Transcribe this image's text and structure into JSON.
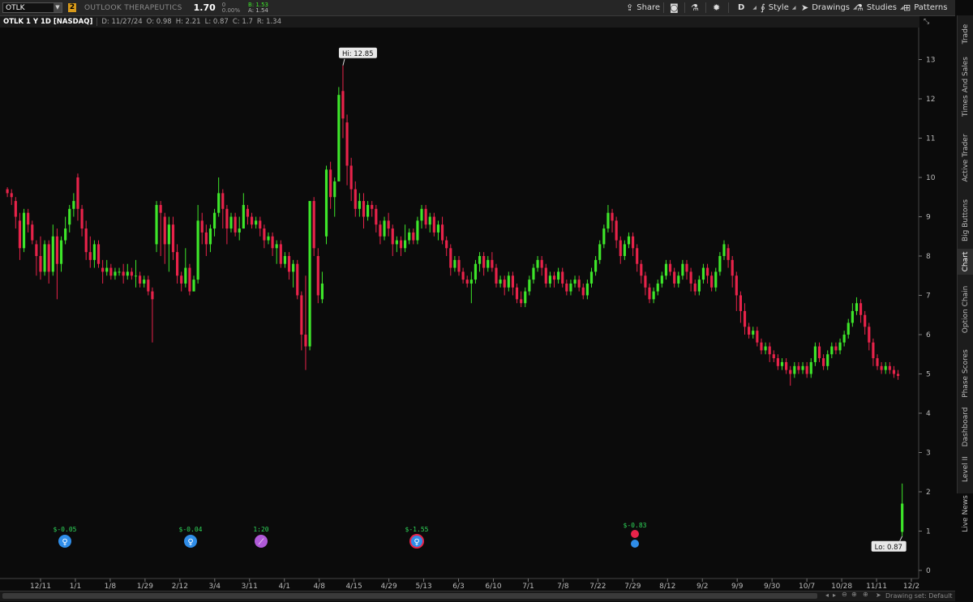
{
  "toolbar": {
    "symbol": "OTLK",
    "link_badge": "2",
    "company": "OUTLOOK THERAPEUTICS",
    "last": "1.70",
    "change": "0",
    "change_pct": "0.00%",
    "bid": "B: 1.53",
    "ask": "A: 1.54",
    "share_label": "Share",
    "aggregation_label": "D",
    "style_label": "Style",
    "drawings_label": "Drawings",
    "studies_label": "Studies",
    "patterns_label": "Patterns"
  },
  "infobar": {
    "title": "OTLK 1 Y 1D [NASDAQ]",
    "date": "D: 11/27/24",
    "open": "O: 0.98",
    "high": "H: 2.21",
    "low": "L: 0.87",
    "close": "C: 1.7",
    "range": "R: 1.34"
  },
  "side_tabs": [
    "Trade",
    "Times And Sales",
    "Active Trader",
    "Big Buttons",
    "Chart",
    "Option Chain",
    "Phase Scores",
    "Dashboard",
    "Level II",
    "Live News"
  ],
  "active_side_tab": "Chart",
  "status": {
    "drawing_set": "Drawing set: Default"
  },
  "colors": {
    "up": "#3ee62a",
    "down": "#e8234a",
    "background": "#0b0b0b",
    "earnings_blue": "#2f8de8",
    "event_purple": "#b05ad8"
  },
  "chart_data": {
    "type": "candlestick",
    "ylim": [
      0,
      13.6
    ],
    "y_ticks": [
      0,
      1,
      2,
      3,
      4,
      5,
      6,
      7,
      8,
      9,
      10,
      11,
      12,
      13
    ],
    "x_ticks": [
      "12/11",
      "1/1",
      "1/8",
      "1/29",
      "2/12",
      "3/4",
      "3/11",
      "4/1",
      "4/8",
      "4/15",
      "4/29",
      "5/13",
      "6/3",
      "6/10",
      "7/1",
      "7/8",
      "7/22",
      "7/29",
      "8/12",
      "9/2",
      "9/9",
      "9/30",
      "10/7",
      "10/28",
      "11/11",
      "12/2"
    ],
    "annotations": {
      "high": "Hi: 12.85",
      "low": "Lo: 0.87"
    },
    "events": [
      {
        "label": "$-0.05",
        "type": "earnings",
        "icon": "lightbulb-icon"
      },
      {
        "label": "$-0.04",
        "type": "earnings",
        "icon": "lightbulb-icon"
      },
      {
        "label": "1:20",
        "type": "split",
        "icon": "split-icon"
      },
      {
        "label": "$-1.55",
        "type": "earnings",
        "icon": "lightbulb-icon"
      },
      {
        "label": "$-0.83",
        "type": "earnings-miss",
        "icon": "lightbulb-icon"
      }
    ],
    "candles": [
      [
        9.7,
        9.6,
        9.75,
        9.5
      ],
      [
        9.6,
        9.5,
        9.7,
        9.3
      ],
      [
        9.4,
        9.0,
        9.5,
        8.7
      ],
      [
        8.9,
        8.2,
        9.1,
        7.9
      ],
      [
        8.2,
        9.1,
        9.2,
        8.1
      ],
      [
        9.1,
        8.8,
        9.2,
        8.6
      ],
      [
        8.8,
        8.4,
        8.9,
        8.3
      ],
      [
        8.3,
        8.0,
        8.4,
        7.5
      ],
      [
        8.0,
        7.6,
        8.5,
        7.4
      ],
      [
        7.6,
        8.3,
        8.4,
        7.5
      ],
      [
        8.3,
        7.6,
        8.4,
        7.3
      ],
      [
        7.6,
        8.5,
        8.8,
        7.5
      ],
      [
        8.5,
        7.8,
        8.7,
        6.9
      ],
      [
        7.8,
        8.4,
        8.5,
        7.6
      ],
      [
        8.4,
        8.7,
        9.0,
        8.3
      ],
      [
        8.8,
        9.2,
        9.3,
        8.6
      ],
      [
        9.2,
        9.4,
        9.6,
        9.0
      ],
      [
        10.0,
        9.2,
        10.1,
        8.9
      ],
      [
        9.2,
        8.7,
        9.3,
        8.5
      ],
      [
        8.7,
        8.1,
        8.9,
        7.9
      ],
      [
        8.1,
        7.9,
        8.5,
        7.7
      ],
      [
        7.9,
        8.3,
        8.4,
        7.7
      ],
      [
        8.3,
        7.8,
        8.4,
        7.7
      ],
      [
        7.7,
        7.6,
        7.9,
        7.3
      ],
      [
        7.6,
        7.7,
        7.9,
        7.5
      ],
      [
        7.7,
        7.5,
        7.8,
        7.4
      ],
      [
        7.5,
        7.6,
        7.7,
        7.4
      ],
      [
        7.6,
        7.6,
        7.7,
        7.5
      ],
      [
        7.6,
        7.5,
        7.8,
        7.3
      ],
      [
        7.5,
        7.6,
        7.8,
        7.4
      ],
      [
        7.6,
        7.5,
        7.7,
        7.4
      ],
      [
        7.5,
        7.5,
        7.9,
        7.2
      ],
      [
        7.5,
        7.3,
        7.6,
        7.2
      ],
      [
        7.3,
        7.4,
        7.5,
        7.2
      ],
      [
        7.4,
        7.1,
        7.5,
        7.0
      ],
      [
        7.1,
        6.9,
        7.2,
        5.8
      ],
      [
        8.3,
        9.3,
        9.4,
        8.1
      ],
      [
        9.3,
        9.1,
        9.4,
        8.0
      ],
      [
        9.0,
        8.3,
        9.1,
        7.8
      ],
      [
        8.3,
        8.8,
        9.0,
        7.6
      ],
      [
        8.8,
        8.1,
        9.0,
        7.9
      ],
      [
        8.1,
        7.5,
        8.3,
        7.3
      ],
      [
        7.5,
        7.3,
        7.6,
        7.1
      ],
      [
        7.3,
        7.7,
        8.2,
        7.2
      ],
      [
        7.7,
        7.1,
        7.8,
        7.0
      ],
      [
        7.1,
        7.4,
        7.5,
        7.1
      ],
      [
        7.4,
        8.9,
        9.3,
        7.3
      ],
      [
        8.9,
        8.6,
        9.1,
        8.3
      ],
      [
        8.6,
        8.3,
        8.8,
        8.0
      ],
      [
        8.3,
        8.7,
        8.8,
        8.1
      ],
      [
        8.7,
        9.1,
        9.2,
        8.5
      ],
      [
        9.1,
        9.6,
        10.0,
        9.0
      ],
      [
        9.6,
        9.2,
        9.7,
        8.7
      ],
      [
        9.2,
        8.7,
        9.3,
        8.3
      ],
      [
        8.7,
        9.0,
        9.1,
        8.6
      ],
      [
        9.0,
        8.6,
        9.1,
        8.5
      ],
      [
        8.6,
        8.7,
        9.0,
        8.4
      ],
      [
        8.7,
        9.3,
        9.6,
        8.7
      ],
      [
        9.2,
        9.0,
        9.3,
        8.8
      ],
      [
        9.0,
        8.8,
        9.1,
        8.7
      ],
      [
        8.8,
        8.9,
        9.0,
        8.7
      ],
      [
        8.9,
        8.7,
        9.0,
        8.5
      ],
      [
        8.7,
        8.4,
        8.8,
        8.2
      ],
      [
        8.4,
        8.5,
        8.6,
        8.3
      ],
      [
        8.5,
        8.2,
        8.6,
        8.0
      ],
      [
        8.2,
        8.3,
        8.4,
        7.8
      ],
      [
        8.3,
        7.8,
        8.4,
        7.7
      ],
      [
        7.8,
        8.0,
        8.1,
        7.7
      ],
      [
        8.0,
        7.6,
        8.1,
        7.4
      ],
      [
        7.6,
        7.8,
        7.9,
        7.2
      ],
      [
        7.8,
        7.0,
        7.9,
        6.9
      ],
      [
        7.0,
        6.0,
        7.1,
        5.6
      ],
      [
        6.0,
        5.7,
        7.5,
        5.1
      ],
      [
        5.7,
        9.4,
        9.4,
        5.6
      ],
      [
        9.4,
        8.2,
        9.5,
        8.0
      ],
      [
        8.0,
        7.0,
        8.2,
        6.8
      ],
      [
        6.9,
        7.3,
        7.6,
        6.8
      ],
      [
        8.5,
        10.2,
        10.3,
        8.3
      ],
      [
        10.2,
        9.5,
        10.4,
        9.2
      ],
      [
        9.5,
        9.9,
        10.0,
        9.0
      ],
      [
        9.9,
        12.1,
        12.3,
        9.9
      ],
      [
        12.2,
        11.5,
        12.85,
        11.0
      ],
      [
        11.4,
        10.3,
        11.6,
        9.8
      ],
      [
        10.3,
        9.7,
        10.5,
        9.4
      ],
      [
        9.7,
        9.2,
        9.9,
        9.0
      ],
      [
        9.2,
        9.4,
        9.6,
        9.0
      ],
      [
        9.4,
        9.0,
        9.6,
        8.7
      ],
      [
        9.0,
        9.3,
        9.4,
        8.9
      ],
      [
        9.3,
        9.2,
        9.4,
        9.0
      ],
      [
        9.2,
        8.8,
        9.3,
        8.6
      ],
      [
        8.8,
        8.5,
        8.9,
        8.3
      ],
      [
        8.5,
        8.9,
        9.0,
        8.4
      ],
      [
        8.9,
        8.7,
        9.1,
        8.5
      ],
      [
        8.7,
        8.3,
        8.8,
        8.0
      ],
      [
        8.3,
        8.4,
        8.5,
        8.1
      ],
      [
        8.4,
        8.2,
        8.5,
        8.0
      ],
      [
        8.2,
        8.4,
        8.8,
        8.1
      ],
      [
        8.4,
        8.6,
        8.7,
        8.3
      ],
      [
        8.6,
        8.4,
        8.7,
        8.3
      ],
      [
        8.4,
        8.9,
        9.0,
        8.3
      ],
      [
        8.9,
        9.2,
        9.3,
        8.7
      ],
      [
        9.2,
        8.8,
        9.3,
        8.7
      ],
      [
        8.8,
        9.0,
        9.1,
        8.6
      ],
      [
        9.0,
        8.6,
        9.1,
        8.5
      ],
      [
        8.6,
        8.8,
        8.9,
        8.4
      ],
      [
        8.8,
        8.4,
        9.0,
        8.3
      ],
      [
        8.4,
        8.2,
        8.5,
        8.0
      ],
      [
        8.2,
        7.7,
        8.3,
        7.5
      ],
      [
        7.7,
        7.9,
        8.0,
        7.6
      ],
      [
        7.9,
        7.6,
        8.0,
        7.5
      ],
      [
        7.6,
        7.4,
        7.7,
        7.3
      ],
      [
        7.4,
        7.3,
        7.5,
        7.2
      ],
      [
        7.3,
        7.4,
        7.6,
        6.8
      ],
      [
        7.4,
        7.8,
        7.9,
        7.3
      ],
      [
        7.8,
        8.0,
        8.1,
        7.6
      ],
      [
        8.0,
        7.7,
        8.1,
        7.5
      ],
      [
        7.7,
        7.9,
        8.0,
        7.6
      ],
      [
        7.9,
        7.7,
        8.1,
        7.6
      ],
      [
        7.7,
        7.3,
        7.8,
        7.2
      ],
      [
        7.3,
        7.4,
        7.5,
        7.2
      ],
      [
        7.4,
        7.2,
        7.5,
        7.0
      ],
      [
        7.2,
        7.5,
        7.6,
        7.1
      ],
      [
        7.5,
        7.2,
        7.6,
        7.0
      ],
      [
        7.2,
        6.9,
        7.3,
        6.8
      ],
      [
        6.9,
        6.8,
        7.1,
        6.7
      ],
      [
        6.8,
        7.1,
        7.2,
        6.7
      ],
      [
        7.1,
        7.4,
        7.5,
        7.0
      ],
      [
        7.4,
        7.7,
        7.8,
        7.3
      ],
      [
        7.7,
        7.9,
        8.0,
        7.6
      ],
      [
        7.9,
        7.7,
        8.0,
        7.5
      ],
      [
        7.7,
        7.3,
        7.8,
        7.2
      ],
      [
        7.3,
        7.5,
        7.6,
        7.2
      ],
      [
        7.5,
        7.4,
        7.6,
        7.2
      ],
      [
        7.4,
        7.6,
        7.7,
        7.3
      ],
      [
        7.6,
        7.3,
        7.7,
        7.2
      ],
      [
        7.3,
        7.1,
        7.4,
        7.0
      ],
      [
        7.1,
        7.3,
        7.4,
        7.0
      ],
      [
        7.3,
        7.4,
        7.5,
        7.2
      ],
      [
        7.4,
        7.2,
        7.5,
        7.1
      ],
      [
        7.2,
        7.0,
        7.3,
        6.9
      ],
      [
        7.0,
        7.3,
        7.4,
        6.9
      ],
      [
        7.3,
        7.6,
        7.7,
        7.2
      ],
      [
        7.6,
        7.9,
        8.0,
        7.5
      ],
      [
        7.9,
        8.3,
        8.4,
        7.8
      ],
      [
        8.3,
        8.7,
        8.8,
        8.2
      ],
      [
        8.7,
        9.1,
        9.3,
        8.6
      ],
      [
        9.1,
        8.9,
        9.2,
        8.6
      ],
      [
        8.9,
        8.4,
        9.0,
        8.2
      ],
      [
        8.4,
        8.0,
        8.5,
        7.8
      ],
      [
        8.0,
        8.3,
        8.4,
        7.9
      ],
      [
        8.3,
        8.5,
        8.6,
        8.2
      ],
      [
        8.5,
        8.2,
        8.6,
        8.0
      ],
      [
        8.2,
        7.8,
        8.3,
        7.6
      ],
      [
        7.8,
        7.5,
        7.9,
        7.3
      ],
      [
        7.5,
        7.2,
        7.6,
        7.0
      ],
      [
        7.2,
        6.9,
        7.3,
        6.8
      ],
      [
        6.9,
        7.1,
        7.2,
        6.8
      ],
      [
        7.1,
        7.3,
        7.4,
        7.0
      ],
      [
        7.3,
        7.5,
        7.6,
        7.2
      ],
      [
        7.5,
        7.8,
        7.9,
        7.4
      ],
      [
        7.8,
        7.6,
        7.9,
        7.5
      ],
      [
        7.6,
        7.3,
        7.7,
        7.2
      ],
      [
        7.3,
        7.5,
        7.6,
        7.2
      ],
      [
        7.5,
        7.8,
        7.9,
        7.4
      ],
      [
        7.8,
        7.6,
        7.9,
        7.4
      ],
      [
        7.6,
        7.3,
        7.7,
        7.1
      ],
      [
        7.3,
        7.1,
        7.4,
        7.0
      ],
      [
        7.1,
        7.4,
        7.5,
        7.0
      ],
      [
        7.4,
        7.7,
        7.8,
        7.3
      ],
      [
        7.7,
        7.5,
        7.8,
        7.3
      ],
      [
        7.5,
        7.2,
        7.6,
        7.1
      ],
      [
        7.2,
        7.6,
        7.7,
        7.1
      ],
      [
        7.6,
        8.0,
        8.1,
        7.5
      ],
      [
        8.0,
        8.3,
        8.4,
        7.9
      ],
      [
        8.2,
        7.9,
        8.3,
        7.7
      ],
      [
        7.9,
        7.5,
        8.0,
        7.2
      ],
      [
        7.5,
        7.0,
        7.6,
        6.6
      ],
      [
        7.0,
        6.6,
        7.1,
        6.3
      ],
      [
        6.6,
        6.2,
        6.8,
        6.0
      ],
      [
        6.2,
        6.0,
        6.3,
        5.9
      ],
      [
        6.0,
        6.1,
        6.2,
        5.9
      ],
      [
        6.1,
        5.8,
        6.2,
        5.7
      ],
      [
        5.8,
        5.6,
        5.9,
        5.5
      ],
      [
        5.6,
        5.7,
        5.8,
        5.5
      ],
      [
        5.7,
        5.5,
        5.8,
        5.3
      ],
      [
        5.5,
        5.4,
        5.6,
        5.3
      ],
      [
        5.4,
        5.2,
        5.5,
        5.1
      ],
      [
        5.2,
        5.3,
        5.4,
        5.1
      ],
      [
        5.3,
        5.1,
        5.4,
        5.0
      ],
      [
        5.1,
        5.0,
        5.2,
        4.7
      ],
      [
        5.0,
        5.2,
        5.3,
        4.9
      ],
      [
        5.2,
        5.1,
        5.3,
        5.0
      ],
      [
        5.1,
        5.2,
        5.3,
        5.0
      ],
      [
        5.2,
        5.0,
        5.3,
        4.9
      ],
      [
        5.0,
        5.3,
        5.4,
        4.9
      ],
      [
        5.3,
        5.7,
        5.8,
        5.2
      ],
      [
        5.7,
        5.4,
        5.8,
        5.3
      ],
      [
        5.4,
        5.2,
        5.5,
        5.1
      ],
      [
        5.2,
        5.5,
        5.6,
        5.1
      ],
      [
        5.5,
        5.7,
        5.8,
        5.4
      ],
      [
        5.7,
        5.6,
        5.8,
        5.5
      ],
      [
        5.6,
        5.8,
        5.9,
        5.5
      ],
      [
        5.8,
        6.0,
        6.1,
        5.7
      ],
      [
        6.0,
        6.3,
        6.4,
        5.9
      ],
      [
        6.3,
        6.6,
        6.8,
        6.2
      ],
      [
        6.6,
        6.8,
        6.95,
        6.5
      ],
      [
        6.8,
        6.5,
        6.9,
        6.3
      ],
      [
        6.5,
        6.2,
        6.6,
        6.0
      ],
      [
        6.2,
        5.8,
        6.3,
        5.6
      ],
      [
        5.8,
        5.4,
        5.9,
        5.2
      ],
      [
        5.4,
        5.2,
        5.5,
        5.1
      ],
      [
        5.2,
        5.1,
        5.3,
        5.0
      ],
      [
        5.1,
        5.2,
        5.3,
        5.0
      ],
      [
        5.2,
        5.1,
        5.3,
        5.0
      ],
      [
        5.1,
        5.0,
        5.2,
        4.9
      ],
      [
        5.0,
        4.95,
        5.1,
        4.85
      ],
      [
        0.98,
        1.7,
        2.21,
        0.87
      ]
    ]
  }
}
